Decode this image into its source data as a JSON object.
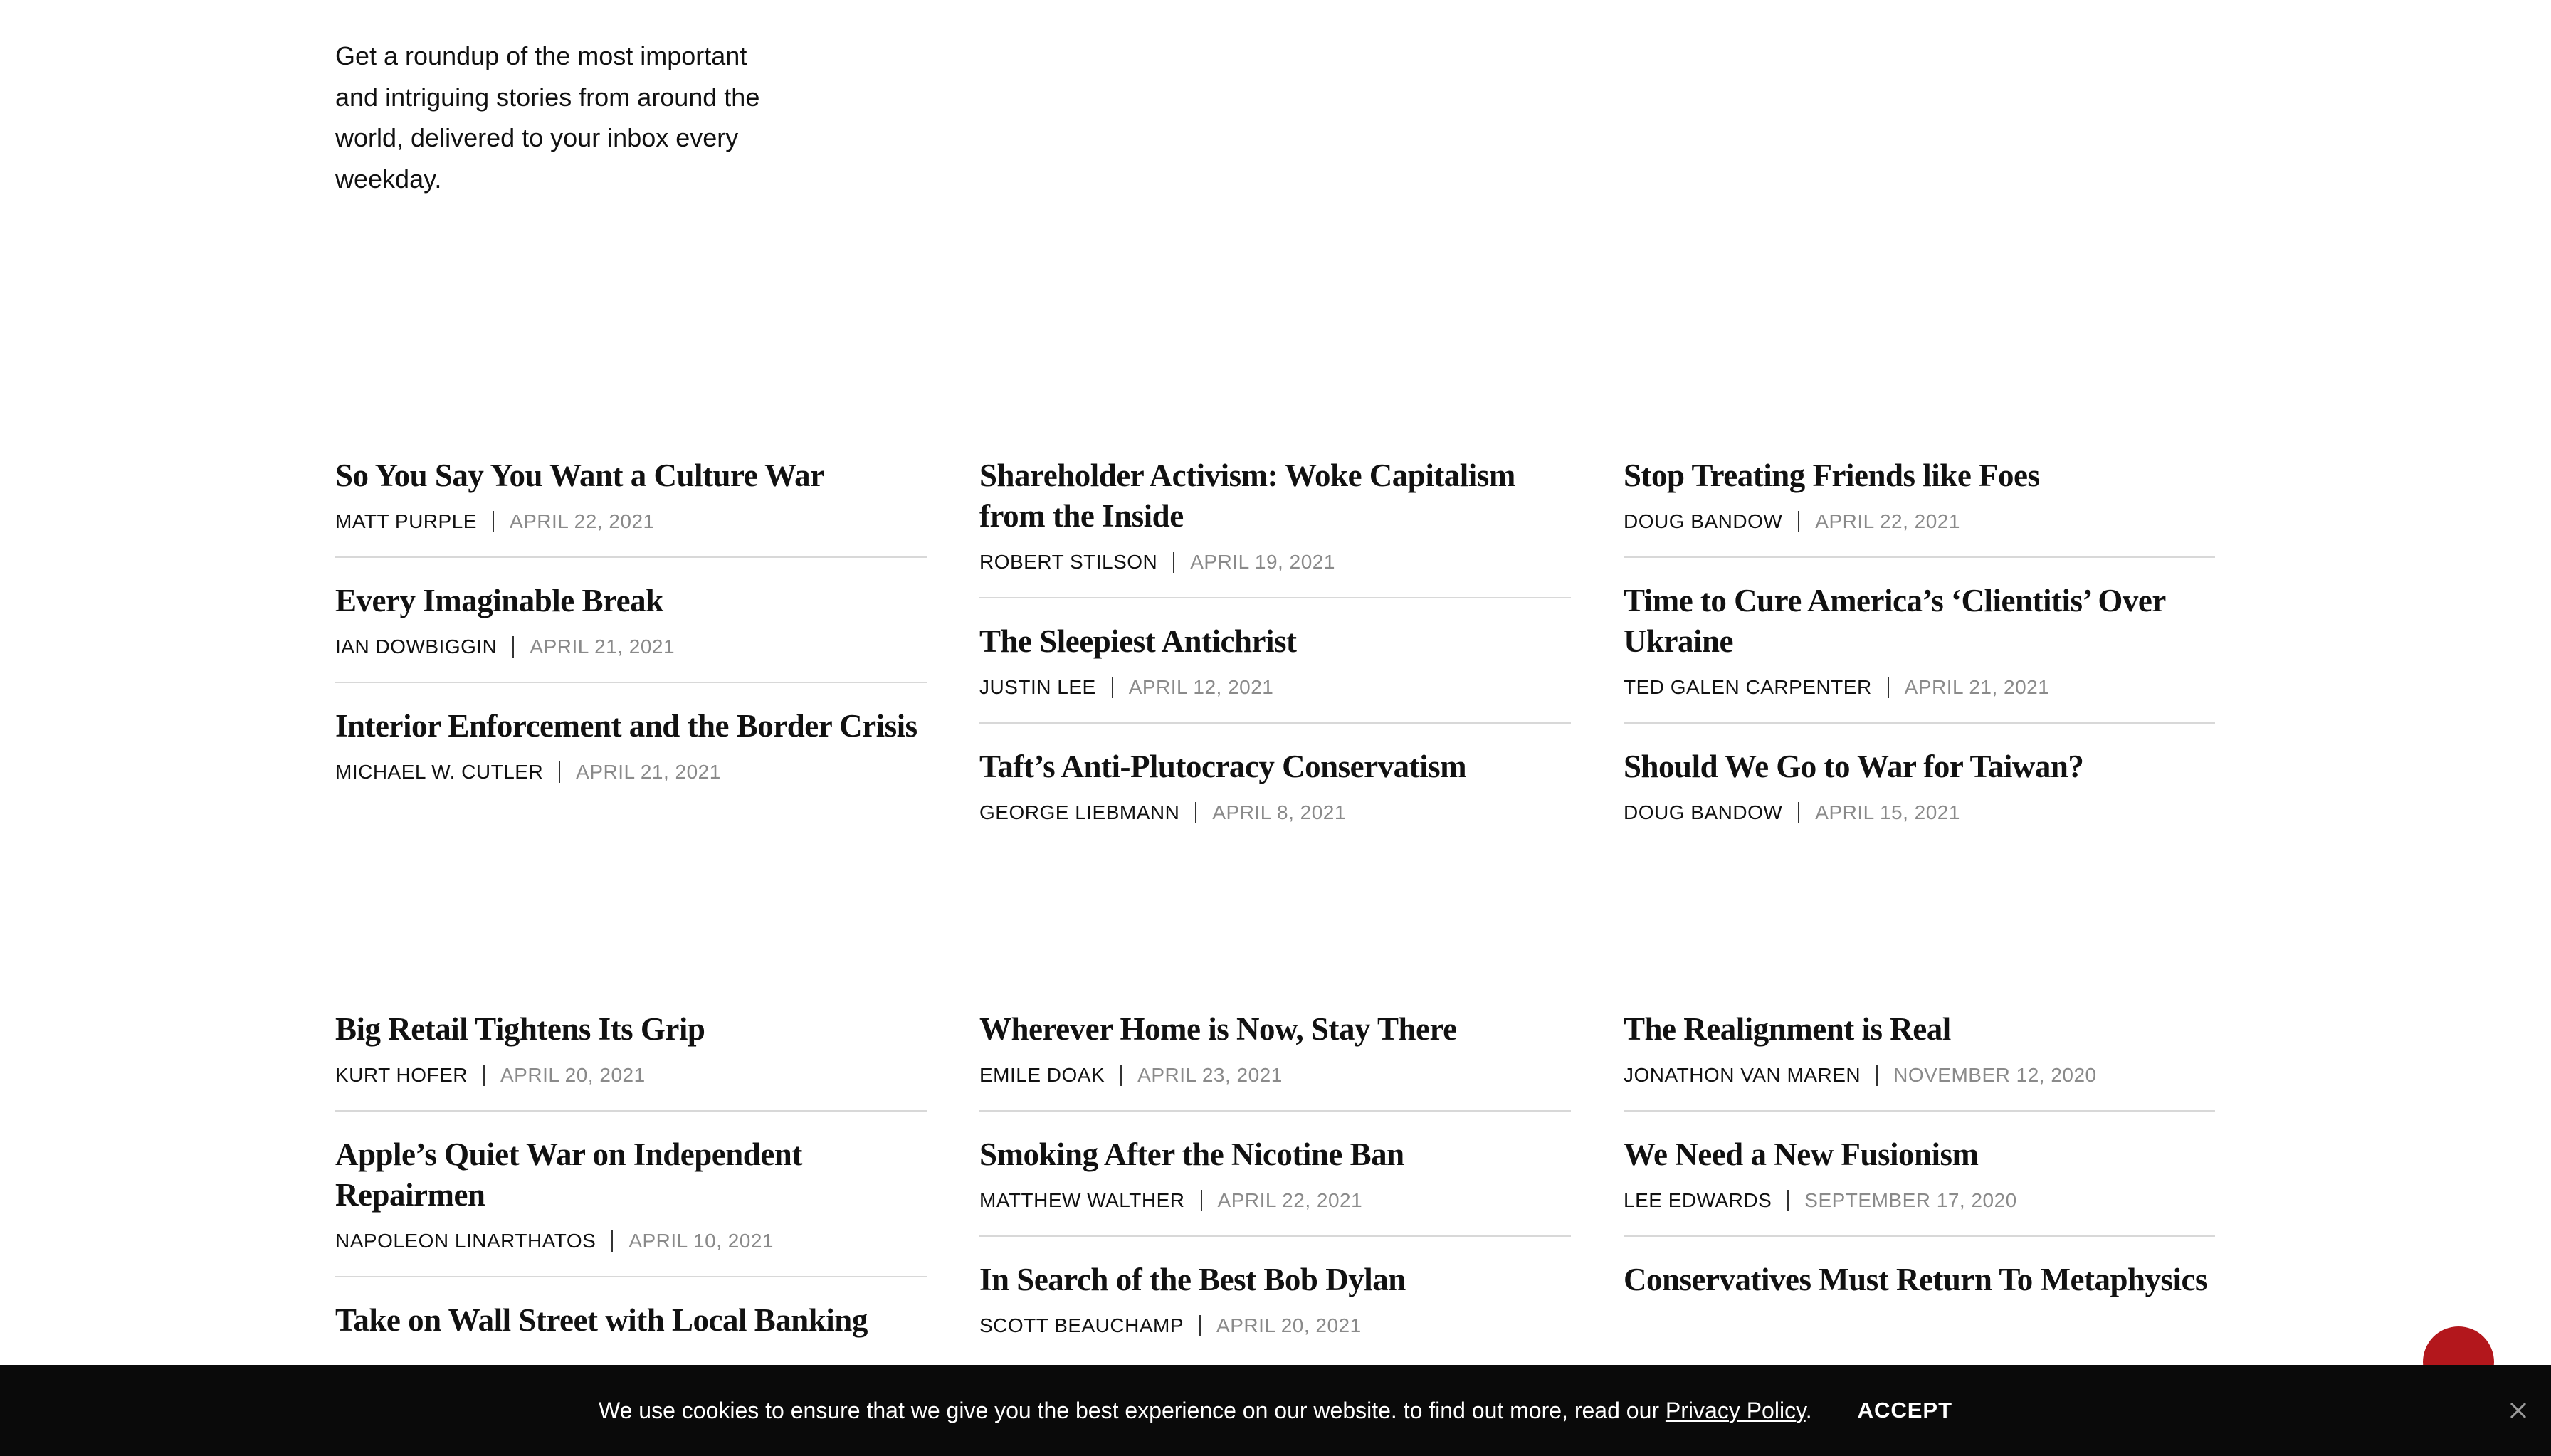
{
  "newsletter": {
    "description": "Get a roundup of the most important and intriguing stories from around the world, delivered to your inbox every weekday."
  },
  "section1": {
    "columns": [
      [
        {
          "title": "So You Say You Want a Culture War",
          "author": "MATT PURPLE",
          "date": "APRIL 22, 2021"
        },
        {
          "title": "Every Imaginable Break",
          "author": "IAN DOWBIGGIN",
          "date": "APRIL 21, 2021"
        },
        {
          "title": "Interior Enforcement and the Border Crisis",
          "author": "MICHAEL W. CUTLER",
          "date": "APRIL 21, 2021"
        }
      ],
      [
        {
          "title": "Shareholder Activism: Woke Capitalism from the Inside",
          "author": "ROBERT STILSON",
          "date": "APRIL 19, 2021"
        },
        {
          "title": "The Sleepiest Antichrist",
          "author": "JUSTIN LEE",
          "date": "APRIL 12, 2021"
        },
        {
          "title": "Taft’s Anti-Plutocracy Conservatism",
          "author": "GEORGE LIEBMANN",
          "date": "APRIL 8, 2021"
        }
      ],
      [
        {
          "title": "Stop Treating Friends like Foes",
          "author": "DOUG BANDOW",
          "date": "APRIL 22, 2021"
        },
        {
          "title": "Time to Cure America’s ‘Clientitis’ Over Ukraine",
          "author": "TED GALEN CARPENTER",
          "date": "APRIL 21, 2021"
        },
        {
          "title": "Should We Go to War for Taiwan?",
          "author": "DOUG BANDOW",
          "date": "APRIL 15, 2021"
        }
      ]
    ]
  },
  "section2": {
    "columns": [
      [
        {
          "title": "Big Retail Tightens Its Grip",
          "author": "KURT HOFER",
          "date": "APRIL 20, 2021"
        },
        {
          "title": "Apple’s Quiet War on Independent Repairmen",
          "author": "NAPOLEON LINARTHATOS",
          "date": "APRIL 10, 2021"
        },
        {
          "title": "Take on Wall Street with Local Banking",
          "author": "",
          "date": ""
        }
      ],
      [
        {
          "title": "Wherever Home is Now, Stay There",
          "author": "EMILE DOAK",
          "date": "APRIL 23, 2021"
        },
        {
          "title": "Smoking After the Nicotine Ban",
          "author": "MATTHEW WALTHER",
          "date": "APRIL 22, 2021"
        },
        {
          "title": "In Search of the Best Bob Dylan",
          "author": "SCOTT BEAUCHAMP",
          "date": "APRIL 20, 2021"
        }
      ],
      [
        {
          "title": "The Realignment is Real",
          "author": "JONATHON VAN MAREN",
          "date": "NOVEMBER 12, 2020"
        },
        {
          "title": "We Need a New Fusionism",
          "author": "LEE EDWARDS",
          "date": "SEPTEMBER 17, 2020"
        },
        {
          "title": "Conservatives Must Return To Metaphysics",
          "author": "",
          "date": ""
        }
      ]
    ]
  },
  "cookie_banner": {
    "text": "We use cookies to ensure that we give you the best experience on our website. to find out more, read our",
    "link_label": "Privacy Policy",
    "period": ".",
    "accept_label": "ACCEPT",
    "close_icon": "close-icon"
  },
  "colors": {
    "fab": "#b3171c",
    "banner_bg": "#0a0a0a",
    "date_gray": "#8a8a8a",
    "divider": "#d8d8d8"
  }
}
